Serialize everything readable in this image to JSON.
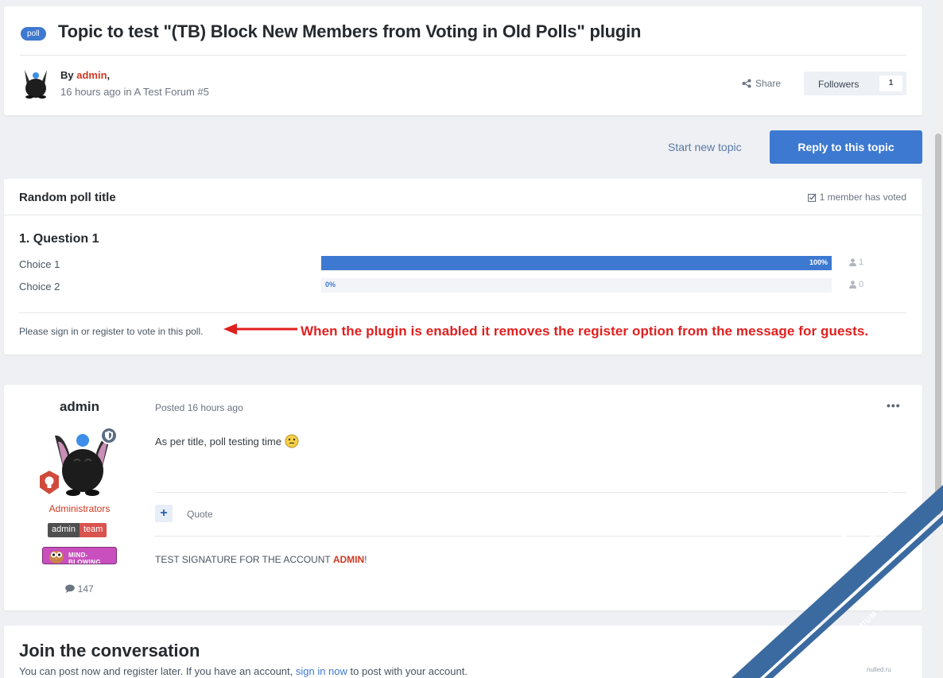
{
  "header": {
    "poll_pill": "poll",
    "title": "Topic to test \"(TB) Block New Members from Voting in Old Polls\" plugin",
    "by_prefix": "By ",
    "author": "admin",
    "by_suffix": ",",
    "meta": "16 hours ago in A Test Forum #5",
    "share_label": "Share",
    "followers_label": "Followers",
    "followers_count": "1"
  },
  "actions": {
    "start_topic": "Start new topic",
    "reply": "Reply to this topic"
  },
  "poll": {
    "title": "Random poll title",
    "voted": "1 member has voted",
    "question": "1. Question 1",
    "choices": [
      {
        "label": "Choice 1",
        "percent": "100%",
        "voters": "1",
        "fraction": 1.0
      },
      {
        "label": "Choice 2",
        "percent": "0%",
        "voters": "0",
        "fraction": 0.0
      }
    ],
    "signin_message": "Please sign in or register to vote in this poll.",
    "annotation": "When the plugin is enabled it removes the register option from the message for guests."
  },
  "post": {
    "author": "admin",
    "role": "Administrators",
    "team_badge_left": "admin",
    "team_badge_right": "team",
    "award_text": "MIND-BLOWING",
    "post_count": "147",
    "posted": "Posted 16 hours ago",
    "menu": "•••",
    "body": "As per title, poll testing time",
    "quote": "Quote",
    "plus": "+",
    "signature_prefix": "TEST SIGNATURE FOR THE ACCOUNT ",
    "signature_strong": "ADMIN",
    "signature_suffix": "!"
  },
  "join": {
    "title": "Join the conversation",
    "text_prefix": "You can post now and register later. If you have an account, ",
    "link": "sign in now",
    "text_suffix": " to post with your account."
  },
  "watermark": {
    "brand": "ENXF.NET",
    "tagline": "XENFORO PREMIUM COMMUNITY",
    "corner": "nulled.ru"
  },
  "colors": {
    "accent": "#3d79d0",
    "author_red": "#d23821",
    "annotation_red": "#e01f1f",
    "watermark_blue": "#3b6aa0"
  }
}
